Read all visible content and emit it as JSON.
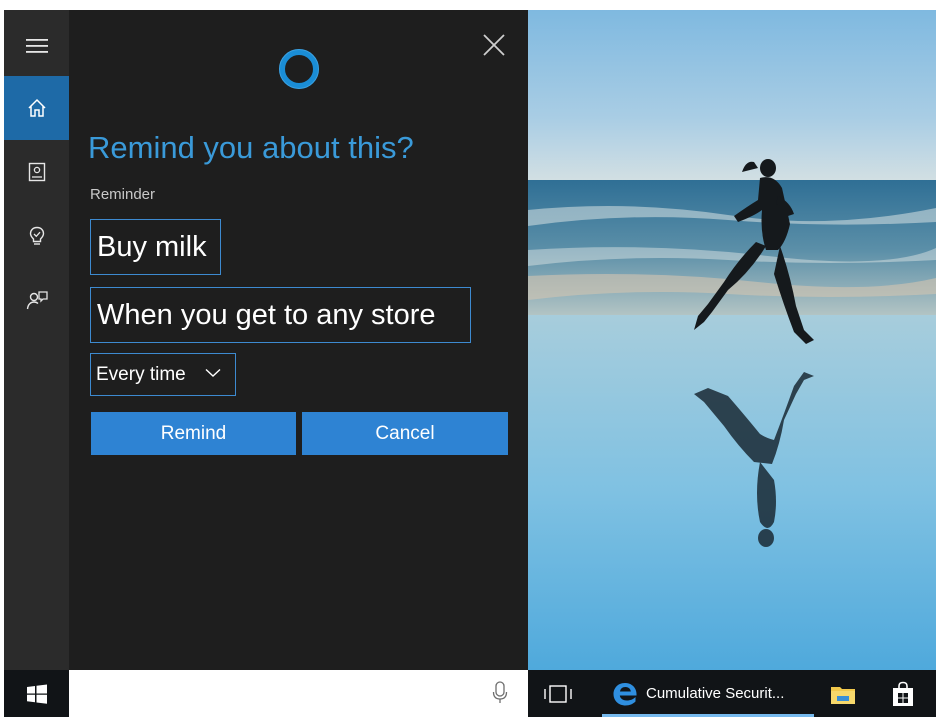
{
  "cortana": {
    "heading": "Remind you about this?",
    "section_label": "Reminder",
    "reminder_title": "Buy milk",
    "trigger": "When you get to any store",
    "repeat": {
      "selected": "Every time"
    },
    "buttons": {
      "remind": "Remind",
      "cancel": "Cancel"
    },
    "rail_icons": [
      "menu-icon",
      "home-icon",
      "notebook-icon",
      "lightbulb-icon",
      "feedback-icon"
    ],
    "colors": {
      "accent": "#3a9ad9",
      "button": "#2e83d3",
      "panel": "#1e1e1e",
      "rail": "#2b2b2b",
      "active_rail": "#1e6aa7"
    }
  },
  "taskbar": {
    "edge_window_title": "Cumulative Securit...",
    "icons": [
      "windows-start-icon",
      "microphone-icon",
      "task-view-icon",
      "edge-icon",
      "file-explorer-icon",
      "store-icon"
    ]
  }
}
